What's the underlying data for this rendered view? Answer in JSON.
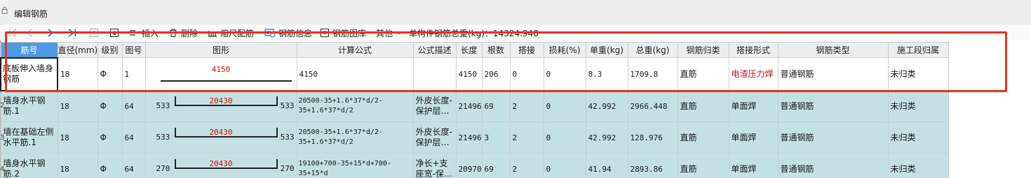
{
  "window": {
    "title": "编辑钢筋"
  },
  "toolbar": {
    "insert": "插入",
    "delete": "删除",
    "ruler": "缩尺配筋",
    "info": "钢筋信息",
    "library": "钢筋图库",
    "other": "其他",
    "total_weight": "单构件钢筋总重(kg)：14324.948"
  },
  "colors": {
    "accent": "#4f9be3",
    "row_bg": "#c4e0e2",
    "highlight": "#e8321f",
    "red_text": "#cc1111"
  },
  "grid": {
    "headers": [
      "筋号",
      "直径(mm)",
      "级别",
      "图号",
      "图形",
      "计算公式",
      "公式描述",
      "长度",
      "根数",
      "搭接",
      "损耗(%)",
      "单重(kg)",
      "总重(kg)",
      "钢筋归类",
      "搭接形式",
      "钢筋类型",
      "施工段归属"
    ],
    "rows": [
      {
        "no": "",
        "name": "底板伸入墙身钢筋",
        "dia": "18",
        "grade": "Φ",
        "fig": "1",
        "left": "",
        "mid": "4150",
        "right": "",
        "formula": "4150",
        "desc": "",
        "len": "4150",
        "count": "206",
        "lap": "0",
        "loss": "0",
        "unit": "8.3",
        "total": "1709.8",
        "cat": "直筋",
        "joint": "电渣压力焊",
        "type": "普通钢筋",
        "stage": "未归类"
      },
      {
        "no": "2",
        "name": "墙身水平钢筋.1",
        "dia": "18",
        "grade": "Φ",
        "fig": "64",
        "left": "533",
        "mid": "20430",
        "right": "533",
        "formula": "20500-35+1.6*37*d/2-35+1.6*37*d/2",
        "desc": "外皮长度-保护层…",
        "len": "21496",
        "count": "69",
        "lap": "2",
        "loss": "0",
        "unit": "42.992",
        "total": "2966.448",
        "cat": "直筋",
        "joint": "单面焊",
        "type": "普通钢筋",
        "stage": "未归类"
      },
      {
        "no": "3",
        "name": "墙在基础左侧水平筋.1",
        "dia": "18",
        "grade": "Φ",
        "fig": "64",
        "left": "533",
        "mid": "20430",
        "right": "533",
        "formula": "20500-35+1.6*37*d/2-35+1.6*37*d/2",
        "desc": "外皮长度-保护层…",
        "len": "21496",
        "count": "3",
        "lap": "2",
        "loss": "0",
        "unit": "42.992",
        "total": "128.976",
        "cat": "直筋",
        "joint": "单面焊",
        "type": "普通钢筋",
        "stage": "未归类"
      },
      {
        "no": "4",
        "name": "墙身水平钢筋.2",
        "dia": "18",
        "grade": "Φ",
        "fig": "64",
        "left": "270",
        "mid": "20430",
        "right": "270",
        "formula": "19100+700-35+15*d+700-35+15*d",
        "desc": "净长+支座宽-保…",
        "len": "20970",
        "count": "69",
        "lap": "2",
        "loss": "0",
        "unit": "41.94",
        "total": "2893.86",
        "cat": "直筋",
        "joint": "单面焊",
        "type": "普通钢筋",
        "stage": "未归类"
      }
    ]
  }
}
